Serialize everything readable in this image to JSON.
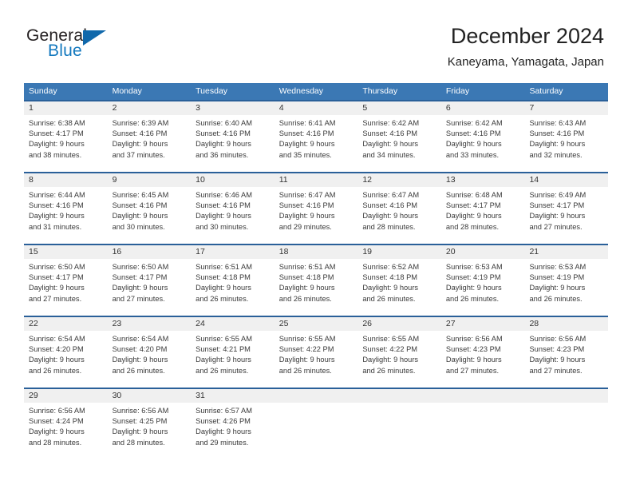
{
  "brand": {
    "name_part1": "General",
    "name_part2": "Blue",
    "triangle_color": "#1068ab",
    "blue_text_color": "#1278be"
  },
  "header": {
    "month_title": "December 2024",
    "location": "Kaneyama, Yamagata, Japan"
  },
  "calendar": {
    "header_bg_color": "#3b78b4",
    "row_separator_color": "#2a6099",
    "day_band_color": "#f0f0f0",
    "weekdays": [
      "Sunday",
      "Monday",
      "Tuesday",
      "Wednesday",
      "Thursday",
      "Friday",
      "Saturday"
    ],
    "weeks": [
      [
        {
          "day": "1",
          "sunrise": "Sunrise: 6:38 AM",
          "sunset": "Sunset: 4:17 PM",
          "daylight_line1": "Daylight: 9 hours",
          "daylight_line2": "and 38 minutes."
        },
        {
          "day": "2",
          "sunrise": "Sunrise: 6:39 AM",
          "sunset": "Sunset: 4:16 PM",
          "daylight_line1": "Daylight: 9 hours",
          "daylight_line2": "and 37 minutes."
        },
        {
          "day": "3",
          "sunrise": "Sunrise: 6:40 AM",
          "sunset": "Sunset: 4:16 PM",
          "daylight_line1": "Daylight: 9 hours",
          "daylight_line2": "and 36 minutes."
        },
        {
          "day": "4",
          "sunrise": "Sunrise: 6:41 AM",
          "sunset": "Sunset: 4:16 PM",
          "daylight_line1": "Daylight: 9 hours",
          "daylight_line2": "and 35 minutes."
        },
        {
          "day": "5",
          "sunrise": "Sunrise: 6:42 AM",
          "sunset": "Sunset: 4:16 PM",
          "daylight_line1": "Daylight: 9 hours",
          "daylight_line2": "and 34 minutes."
        },
        {
          "day": "6",
          "sunrise": "Sunrise: 6:42 AM",
          "sunset": "Sunset: 4:16 PM",
          "daylight_line1": "Daylight: 9 hours",
          "daylight_line2": "and 33 minutes."
        },
        {
          "day": "7",
          "sunrise": "Sunrise: 6:43 AM",
          "sunset": "Sunset: 4:16 PM",
          "daylight_line1": "Daylight: 9 hours",
          "daylight_line2": "and 32 minutes."
        }
      ],
      [
        {
          "day": "8",
          "sunrise": "Sunrise: 6:44 AM",
          "sunset": "Sunset: 4:16 PM",
          "daylight_line1": "Daylight: 9 hours",
          "daylight_line2": "and 31 minutes."
        },
        {
          "day": "9",
          "sunrise": "Sunrise: 6:45 AM",
          "sunset": "Sunset: 4:16 PM",
          "daylight_line1": "Daylight: 9 hours",
          "daylight_line2": "and 30 minutes."
        },
        {
          "day": "10",
          "sunrise": "Sunrise: 6:46 AM",
          "sunset": "Sunset: 4:16 PM",
          "daylight_line1": "Daylight: 9 hours",
          "daylight_line2": "and 30 minutes."
        },
        {
          "day": "11",
          "sunrise": "Sunrise: 6:47 AM",
          "sunset": "Sunset: 4:16 PM",
          "daylight_line1": "Daylight: 9 hours",
          "daylight_line2": "and 29 minutes."
        },
        {
          "day": "12",
          "sunrise": "Sunrise: 6:47 AM",
          "sunset": "Sunset: 4:16 PM",
          "daylight_line1": "Daylight: 9 hours",
          "daylight_line2": "and 28 minutes."
        },
        {
          "day": "13",
          "sunrise": "Sunrise: 6:48 AM",
          "sunset": "Sunset: 4:17 PM",
          "daylight_line1": "Daylight: 9 hours",
          "daylight_line2": "and 28 minutes."
        },
        {
          "day": "14",
          "sunrise": "Sunrise: 6:49 AM",
          "sunset": "Sunset: 4:17 PM",
          "daylight_line1": "Daylight: 9 hours",
          "daylight_line2": "and 27 minutes."
        }
      ],
      [
        {
          "day": "15",
          "sunrise": "Sunrise: 6:50 AM",
          "sunset": "Sunset: 4:17 PM",
          "daylight_line1": "Daylight: 9 hours",
          "daylight_line2": "and 27 minutes."
        },
        {
          "day": "16",
          "sunrise": "Sunrise: 6:50 AM",
          "sunset": "Sunset: 4:17 PM",
          "daylight_line1": "Daylight: 9 hours",
          "daylight_line2": "and 27 minutes."
        },
        {
          "day": "17",
          "sunrise": "Sunrise: 6:51 AM",
          "sunset": "Sunset: 4:18 PM",
          "daylight_line1": "Daylight: 9 hours",
          "daylight_line2": "and 26 minutes."
        },
        {
          "day": "18",
          "sunrise": "Sunrise: 6:51 AM",
          "sunset": "Sunset: 4:18 PM",
          "daylight_line1": "Daylight: 9 hours",
          "daylight_line2": "and 26 minutes."
        },
        {
          "day": "19",
          "sunrise": "Sunrise: 6:52 AM",
          "sunset": "Sunset: 4:18 PM",
          "daylight_line1": "Daylight: 9 hours",
          "daylight_line2": "and 26 minutes."
        },
        {
          "day": "20",
          "sunrise": "Sunrise: 6:53 AM",
          "sunset": "Sunset: 4:19 PM",
          "daylight_line1": "Daylight: 9 hours",
          "daylight_line2": "and 26 minutes."
        },
        {
          "day": "21",
          "sunrise": "Sunrise: 6:53 AM",
          "sunset": "Sunset: 4:19 PM",
          "daylight_line1": "Daylight: 9 hours",
          "daylight_line2": "and 26 minutes."
        }
      ],
      [
        {
          "day": "22",
          "sunrise": "Sunrise: 6:54 AM",
          "sunset": "Sunset: 4:20 PM",
          "daylight_line1": "Daylight: 9 hours",
          "daylight_line2": "and 26 minutes."
        },
        {
          "day": "23",
          "sunrise": "Sunrise: 6:54 AM",
          "sunset": "Sunset: 4:20 PM",
          "daylight_line1": "Daylight: 9 hours",
          "daylight_line2": "and 26 minutes."
        },
        {
          "day": "24",
          "sunrise": "Sunrise: 6:55 AM",
          "sunset": "Sunset: 4:21 PM",
          "daylight_line1": "Daylight: 9 hours",
          "daylight_line2": "and 26 minutes."
        },
        {
          "day": "25",
          "sunrise": "Sunrise: 6:55 AM",
          "sunset": "Sunset: 4:22 PM",
          "daylight_line1": "Daylight: 9 hours",
          "daylight_line2": "and 26 minutes."
        },
        {
          "day": "26",
          "sunrise": "Sunrise: 6:55 AM",
          "sunset": "Sunset: 4:22 PM",
          "daylight_line1": "Daylight: 9 hours",
          "daylight_line2": "and 26 minutes."
        },
        {
          "day": "27",
          "sunrise": "Sunrise: 6:56 AM",
          "sunset": "Sunset: 4:23 PM",
          "daylight_line1": "Daylight: 9 hours",
          "daylight_line2": "and 27 minutes."
        },
        {
          "day": "28",
          "sunrise": "Sunrise: 6:56 AM",
          "sunset": "Sunset: 4:23 PM",
          "daylight_line1": "Daylight: 9 hours",
          "daylight_line2": "and 27 minutes."
        }
      ],
      [
        {
          "day": "29",
          "sunrise": "Sunrise: 6:56 AM",
          "sunset": "Sunset: 4:24 PM",
          "daylight_line1": "Daylight: 9 hours",
          "daylight_line2": "and 28 minutes."
        },
        {
          "day": "30",
          "sunrise": "Sunrise: 6:56 AM",
          "sunset": "Sunset: 4:25 PM",
          "daylight_line1": "Daylight: 9 hours",
          "daylight_line2": "and 28 minutes."
        },
        {
          "day": "31",
          "sunrise": "Sunrise: 6:57 AM",
          "sunset": "Sunset: 4:26 PM",
          "daylight_line1": "Daylight: 9 hours",
          "daylight_line2": "and 29 minutes."
        },
        {
          "day": "",
          "sunrise": "",
          "sunset": "",
          "daylight_line1": "",
          "daylight_line2": ""
        },
        {
          "day": "",
          "sunrise": "",
          "sunset": "",
          "daylight_line1": "",
          "daylight_line2": ""
        },
        {
          "day": "",
          "sunrise": "",
          "sunset": "",
          "daylight_line1": "",
          "daylight_line2": ""
        },
        {
          "day": "",
          "sunrise": "",
          "sunset": "",
          "daylight_line1": "",
          "daylight_line2": ""
        }
      ]
    ]
  }
}
